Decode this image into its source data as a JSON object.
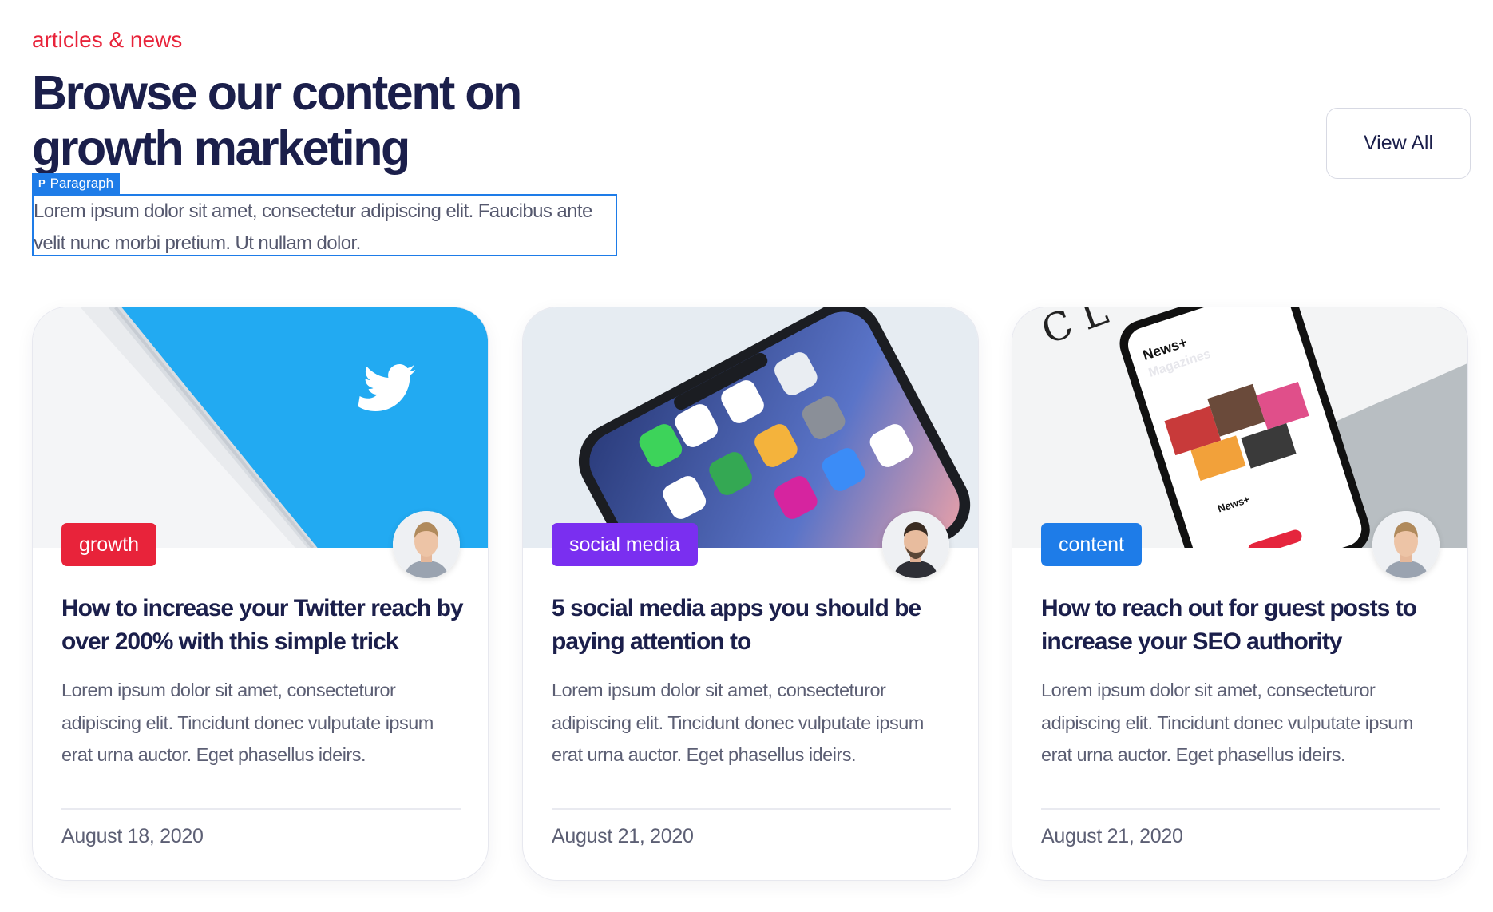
{
  "header": {
    "eyebrow": "articles & news",
    "title": "Browse our content on growth marketing",
    "selection_label": "Paragraph",
    "paragraph": "Lorem ipsum dolor sit amet, consectetur adipiscing elit. Faucibus ante velit nunc morbi pretium. Ut nullam dolor.",
    "view_all_label": "View All"
  },
  "cards": [
    {
      "tag": "growth",
      "tag_color": "#e8233a",
      "image": "twitter-app-phone-image",
      "title": "How to increase your Twitter reach by over 200% with this simple trick",
      "description": "Lorem ipsum dolor sit amet, consecteturor adipiscing elit. Tincidunt donec vulputate ipsum erat urna auctor. Eget phasellus ideirs.",
      "date": "August 18, 2020"
    },
    {
      "tag": "social media",
      "tag_color": "#7a2ff0",
      "image": "smartphone-apps-image",
      "title": "5 social media apps you should be paying attention to",
      "description": "Lorem ipsum dolor sit amet, consecteturor adipiscing elit. Tincidunt donec vulputate ipsum erat urna auctor. Eget phasellus ideirs.",
      "date": "August 21, 2020"
    },
    {
      "tag": "content",
      "tag_color": "#1e7ce8",
      "image": "apple-news-phone-image",
      "title": "How to reach out for guest posts to increase your SEO authority",
      "description": "Lorem ipsum dolor sit amet, consecteturor adipiscing elit. Tincidunt donec vulputate ipsum erat urna auctor. Eget phasellus ideirs.",
      "date": "August 21, 2020"
    }
  ],
  "colors": {
    "heading": "#1b1f4b",
    "accent_red": "#e8233a",
    "selection_blue": "#1e7ce8",
    "body_text": "#5c5f74"
  }
}
